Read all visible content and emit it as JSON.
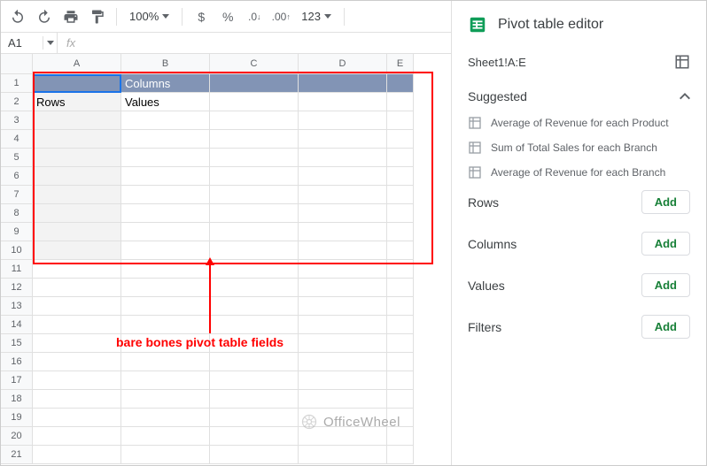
{
  "toolbar": {
    "zoom": "100%",
    "format_123": "123"
  },
  "namebox": "A1",
  "fx_symbol": "fx",
  "columns": [
    "A",
    "B",
    "C",
    "D",
    "E"
  ],
  "pivot_cells": {
    "columns_label": "Columns",
    "rows_label": "Rows",
    "values_label": "Values"
  },
  "annotation": "bare bones pivot table fields",
  "watermark": "OfficeWheel",
  "editor": {
    "title": "Pivot table editor",
    "range": "Sheet1!A:E",
    "suggested_label": "Suggested",
    "suggestions": [
      "Average of Revenue for each Product",
      "Sum of Total Sales for each Branch",
      "Average of Revenue for each Branch"
    ],
    "sections": {
      "rows": "Rows",
      "columns": "Columns",
      "values": "Values",
      "filters": "Filters"
    },
    "add_label": "Add"
  }
}
